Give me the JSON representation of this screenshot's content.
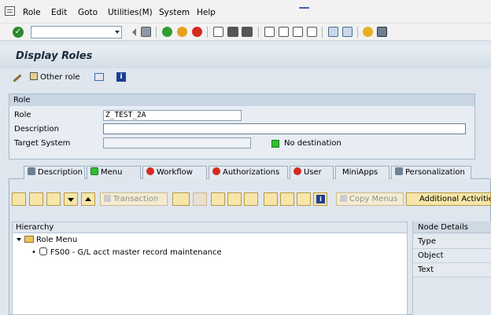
{
  "menu": {
    "items": [
      "Role",
      "Edit",
      "Goto",
      "Utilities(M)",
      "System",
      "Help"
    ]
  },
  "toolbar": {
    "command_field": ""
  },
  "title": "Display Roles",
  "app_toolbar": {
    "other_role": "Other role"
  },
  "role_group": {
    "title": "Role",
    "role_label": "Role",
    "role_value": "Z_TEST_2A",
    "description_label": "Description",
    "description_value": "",
    "target_system_label": "Target System",
    "target_system_value": "",
    "destination_status": "No destination"
  },
  "tabs": [
    "Description",
    "Menu",
    "Workflow",
    "Authorizations",
    "User",
    "MiniApps",
    "Personalization"
  ],
  "menu_toolbar": {
    "transaction": "Transaction",
    "copy_menus": "Copy Menus",
    "additional_activities": "Additional Activities"
  },
  "hierarchy": {
    "header": "Hierarchy",
    "root": "Role Menu",
    "child": "FS00 - G/L acct master record maintenance"
  },
  "node_details": {
    "header": "Node Details",
    "fields": [
      "Type",
      "Object",
      "Text"
    ]
  },
  "colors": {
    "green_status": "#2fbf2f",
    "tab_active_green": "#2fbf2f",
    "tab_red": "#d62a1e",
    "button_yellow": "#f7e6a8"
  }
}
